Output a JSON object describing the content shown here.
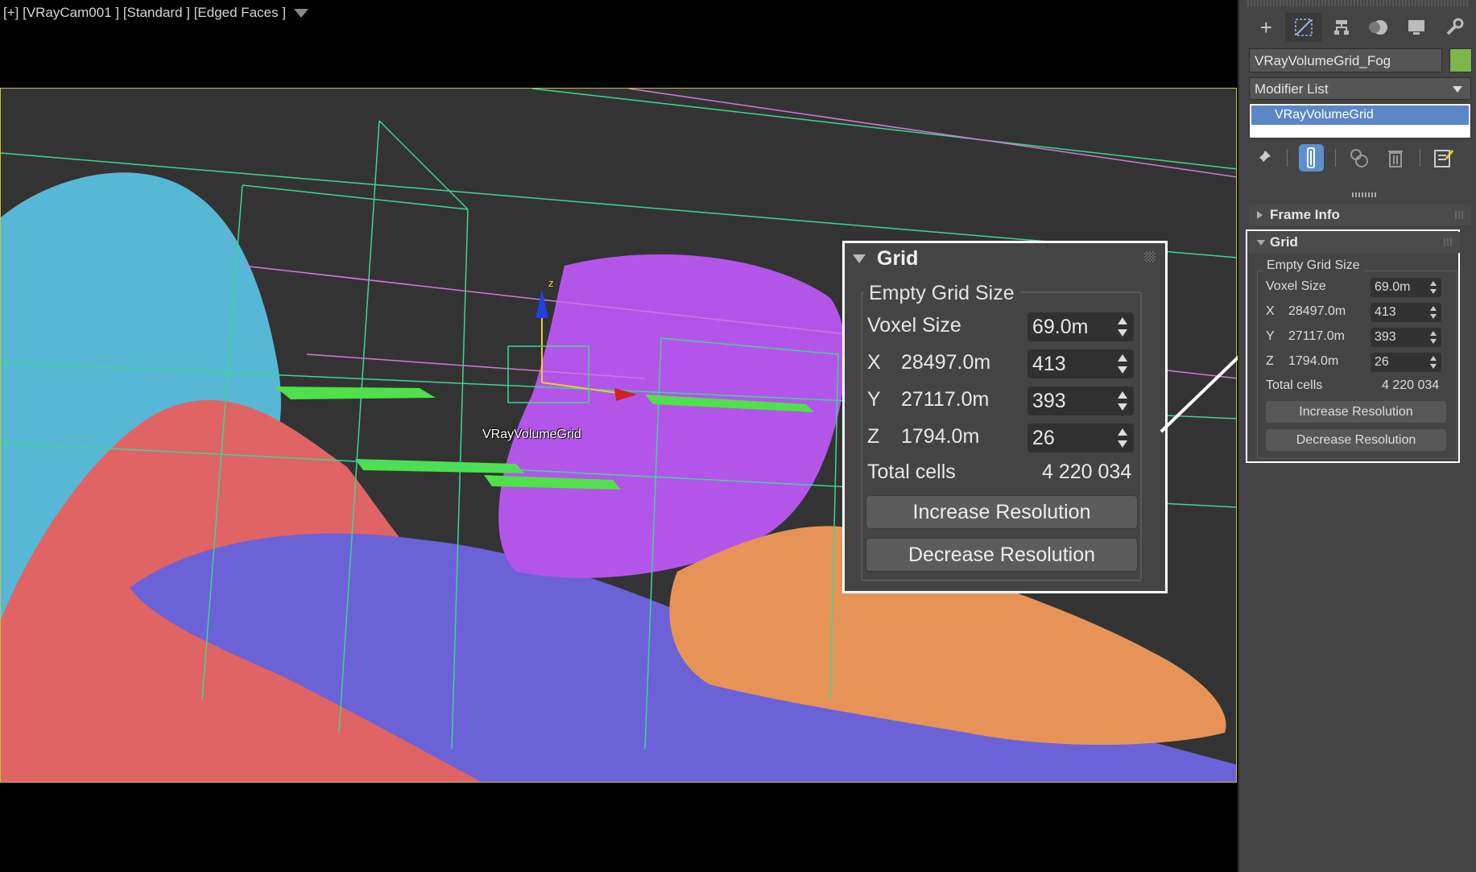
{
  "viewport": {
    "label": "[+] [VRayCam001 ] [Standard ] [Edged Faces ]",
    "object_label": "VRayVolumeGrid"
  },
  "zoom_panel": {
    "title": "Grid",
    "group_title": "Empty Grid Size",
    "voxel_label": "Voxel Size",
    "voxel_value": "69.0m",
    "x_label": "X",
    "x_size": "28497.0m",
    "x_value": "413",
    "y_label": "Y",
    "y_size": "27117.0m",
    "y_value": "393",
    "z_label": "Z",
    "z_size": "1794.0m",
    "z_value": "26",
    "total_label": "Total cells",
    "total_value": "4 220 034",
    "increase_label": "Increase Resolution",
    "decrease_label": "Decrease Resolution"
  },
  "command_panel": {
    "tabs": [
      "create-icon",
      "modify-icon",
      "hierarchy-icon",
      "motion-icon",
      "display-icon",
      "utilities-icon"
    ],
    "object_name": "VRayVolumeGrid_Fog",
    "object_color": "#7ab648",
    "modifier_list_label": "Modifier List",
    "stack_item": "VRayVolumeGrid",
    "frame_info_label": "Frame Info",
    "grid_label": "Grid",
    "group_title": "Empty Grid Size",
    "voxel_label": "Voxel Size",
    "voxel_value": "69.0m",
    "x_label": "X",
    "x_size": "28497.0m",
    "x_value": "413",
    "y_label": "Y",
    "y_size": "27117.0m",
    "y_value": "393",
    "z_label": "Z",
    "z_size": "1794.0m",
    "z_value": "26",
    "total_label": "Total cells",
    "total_value": "4 220 034",
    "increase_label": "Increase Resolution",
    "decrease_label": "Decrease Resolution"
  },
  "colors": {
    "accent_blue": "#5b87c7",
    "viewport_border": "#c8c236"
  }
}
